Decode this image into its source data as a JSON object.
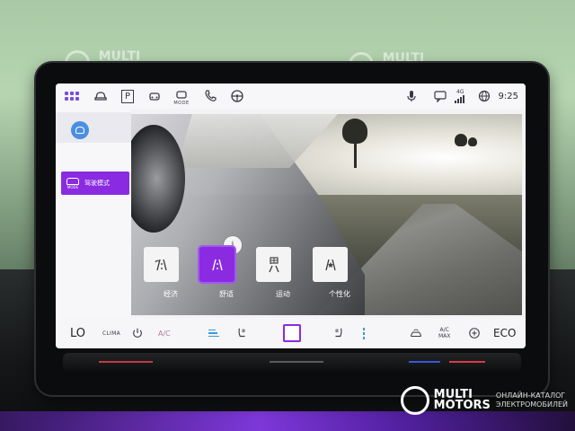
{
  "status_bar": {
    "time": "9:25",
    "network": "4G",
    "icons": [
      "apps-grid-icon",
      "car-icon",
      "parking-icon",
      "car-front-icon",
      "drive-mode-icon",
      "phone-icon",
      "steering-wheel-icon",
      "microphone-icon",
      "message-icon",
      "signal-icon",
      "globe-icon"
    ],
    "mode_text": "MODE",
    "parking_text": "P"
  },
  "left_panel": {
    "items": [
      {
        "name": "profile",
        "icon": "avatar-icon"
      },
      {
        "name": "drive-mode",
        "label": "驾驶模式",
        "icon_caption": "MODE",
        "active": true
      }
    ]
  },
  "drive_modes": [
    {
      "label": "经济",
      "icon": "eco-road-icon",
      "active": false
    },
    {
      "label": "舒适",
      "icon": "comfort-road-icon",
      "active": true
    },
    {
      "label": "运动",
      "icon": "sport-flag-icon",
      "active": false
    },
    {
      "label": "个性化",
      "icon": "individual-road-icon",
      "active": false
    }
  ],
  "info_badge": "i",
  "climate_bar": {
    "left_temp": "LO",
    "clima_label": "CLIMA",
    "ac_label": "A/C",
    "ac_max_top": "A/C",
    "ac_max_bottom": "MAX",
    "right_mode": "ECO",
    "accent": "#8a2be2",
    "vent_color": "#3a9ad9"
  },
  "watermark": {
    "brand_line1": "MULTI",
    "brand_line2": "MOTORS",
    "tagline_line1": "ОНЛАЙН-КАТАЛОГ",
    "tagline_line2": "ЭЛЕКТРОМОБИЛЕЙ"
  }
}
